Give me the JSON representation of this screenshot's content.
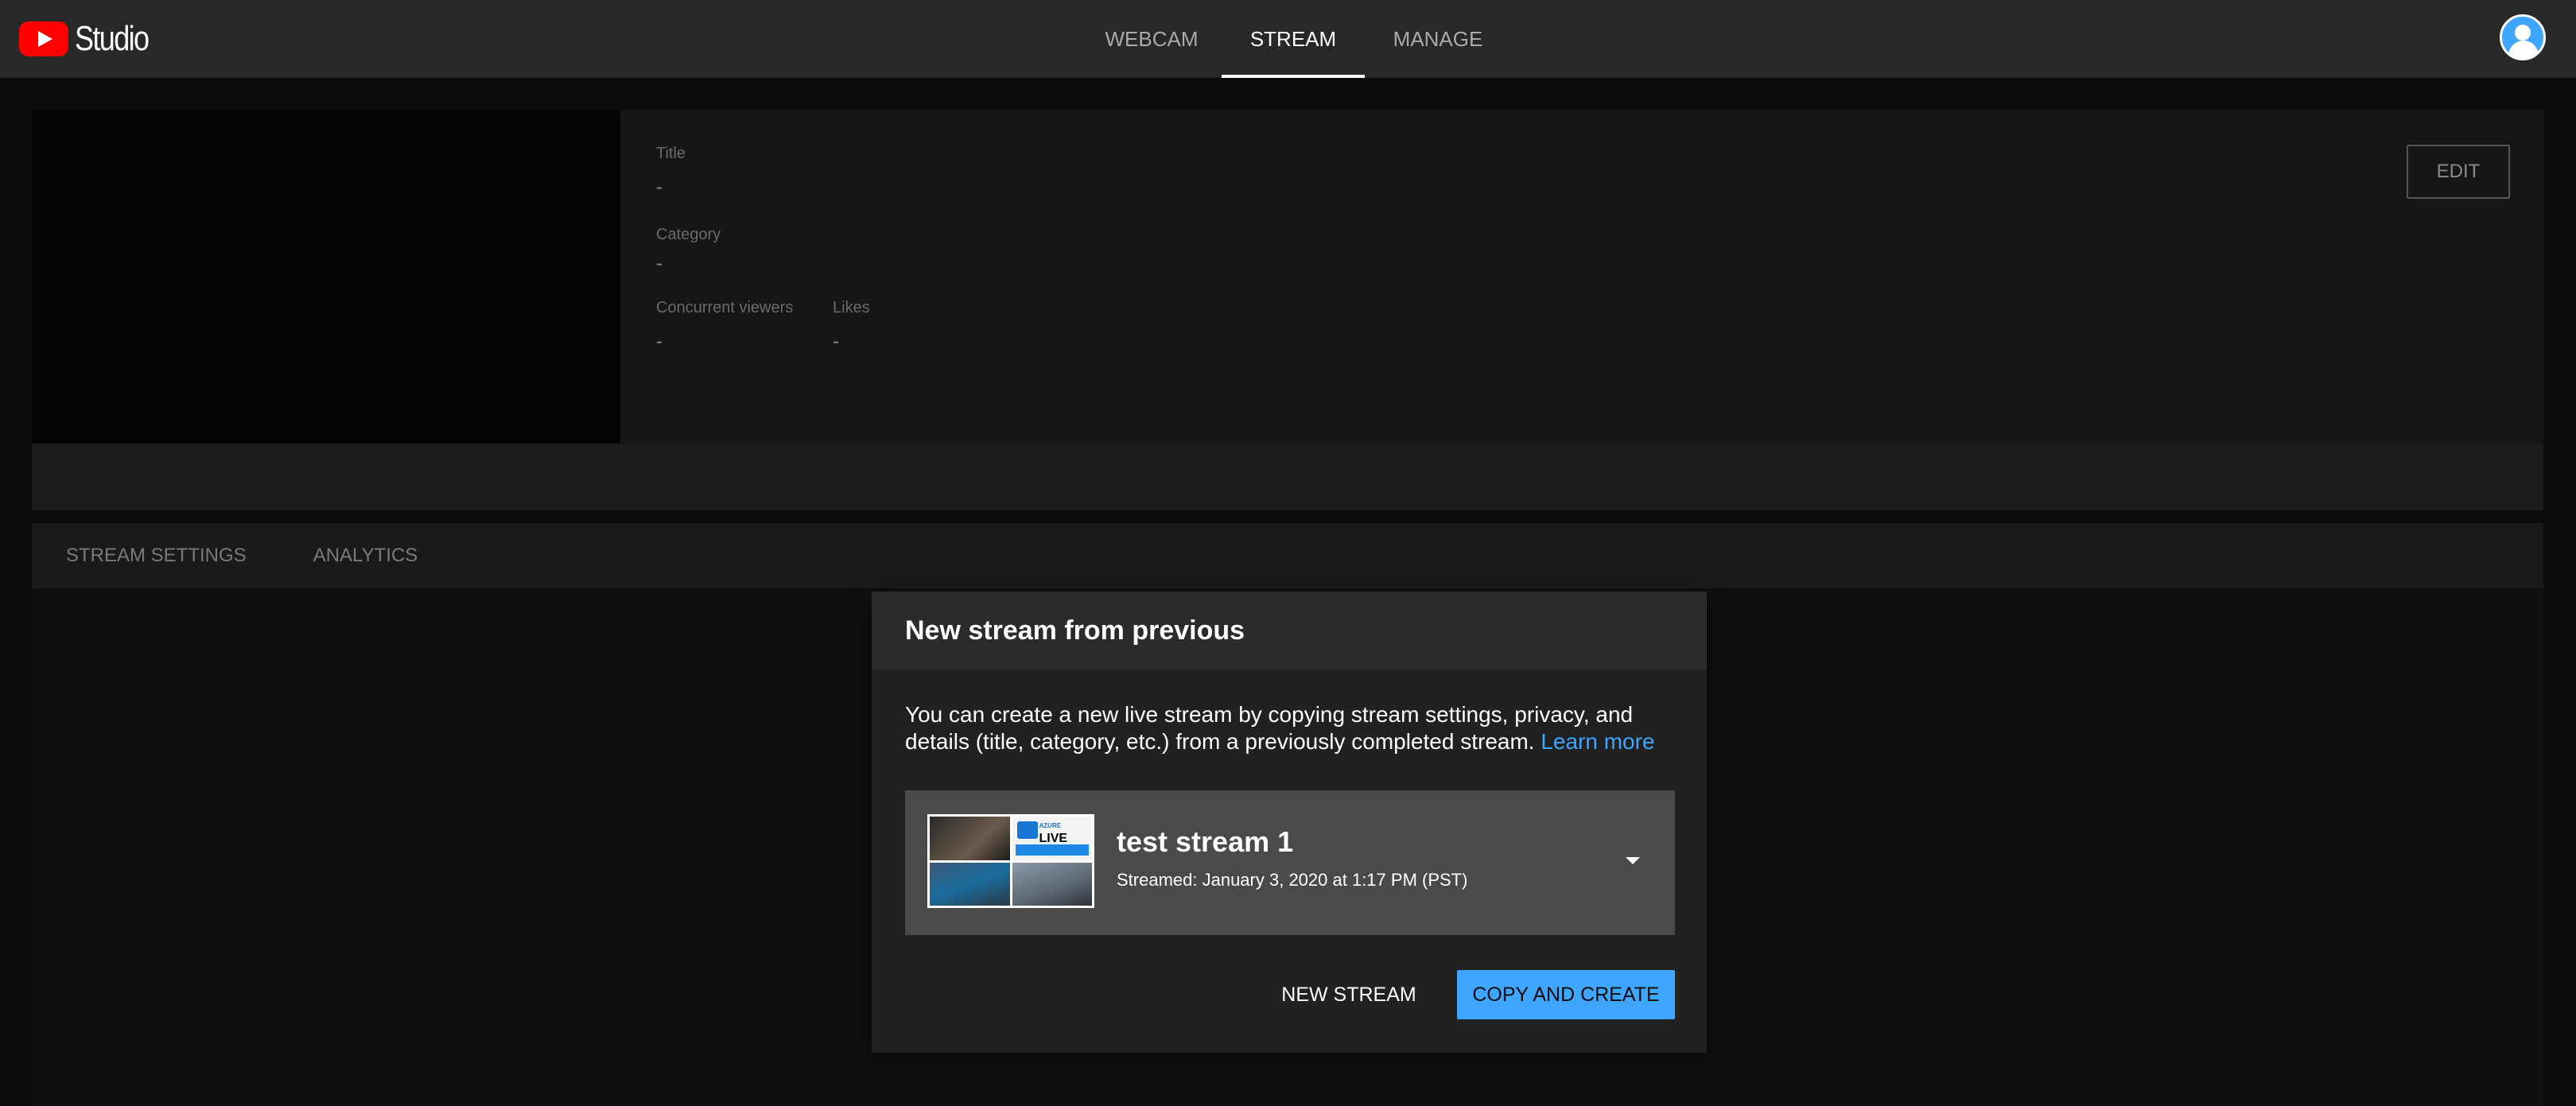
{
  "app": {
    "logo_text": "Studio",
    "logo_icon": "youtube-play-icon"
  },
  "nav": {
    "tabs": [
      {
        "label": "WEBCAM"
      },
      {
        "label": "STREAM",
        "active": true
      },
      {
        "label": "MANAGE"
      }
    ]
  },
  "account": {
    "icon": "account-avatar-icon"
  },
  "stream_info": {
    "title_label": "Title",
    "title_value": "-",
    "category_label": "Category",
    "category_value": "-",
    "viewers_label": "Concurrent viewers",
    "viewers_value": "-",
    "likes_label": "Likes",
    "likes_value": "-",
    "edit_label": "EDIT"
  },
  "section_tabs": [
    {
      "label": "STREAM SETTINGS"
    },
    {
      "label": "ANALYTICS"
    }
  ],
  "dialog": {
    "title": "New stream from previous",
    "body": "You can create a new live stream by copying stream settings, privacy, and details (title, category, etc.) from a previously completed stream.",
    "link": "Learn more",
    "selected_stream": {
      "title": "test stream 1",
      "subtitle": "Streamed: January 3, 2020 at 1:17 PM (PST)"
    },
    "new_stream_label": "NEW STREAM",
    "copy_create_label": "COPY AND CREATE"
  },
  "colors": {
    "accent": "#3ea6ff",
    "brand": "#ff0000",
    "topbar": "#282828"
  }
}
